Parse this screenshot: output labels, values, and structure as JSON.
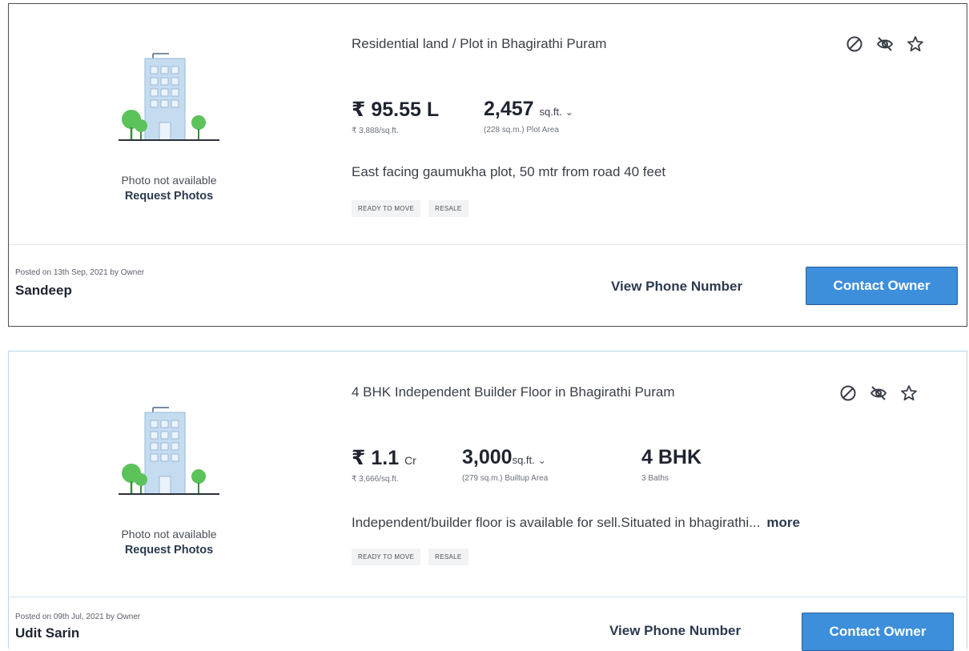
{
  "listings": [
    {
      "title": "Residential land / Plot in Bhagirathi Puram",
      "price": "₹ 95.55 L",
      "price_unit": "",
      "price_per_sqft": "₹ 3,888/sq.ft.",
      "area_value": "2,457",
      "area_unit": "sq.ft.",
      "area_note": "(228 sq.m.) Plot Area",
      "bhk": "",
      "baths": "",
      "description": "East facing gaumukha plot, 50 mtr from road 40 feet",
      "more_label": "",
      "tags": [
        "READY TO MOVE",
        "RESALE"
      ],
      "photo_status": "Photo not available",
      "request_photos_label": "Request Photos",
      "posted": "Posted on 13th Sep, 2021 by Owner",
      "owner_name": "Sandeep",
      "view_phone_label": "View Phone Number",
      "contact_label": "Contact Owner"
    },
    {
      "title": "4 BHK Independent Builder Floor in Bhagirathi Puram",
      "price": "₹ 1.1",
      "price_unit": "Cr",
      "price_per_sqft": "₹ 3,666/sq.ft.",
      "area_value": "3,000",
      "area_unit": "sq.ft.",
      "area_note": "(279 sq.m.) Builtup Area",
      "bhk": "4 BHK",
      "baths": "3 Baths",
      "description": "Independent/builder floor is available for sell.Situated in bhagirathi...",
      "more_label": "more",
      "tags": [
        "READY TO MOVE",
        "RESALE"
      ],
      "photo_status": "Photo not available",
      "request_photos_label": "Request Photos",
      "posted": "Posted on 09th Jul, 2021 by Owner",
      "owner_name": "Udit Sarin",
      "view_phone_label": "View Phone Number",
      "contact_label": "Contact Owner"
    }
  ],
  "icons": [
    "block-icon",
    "hide-icon",
    "star-icon"
  ],
  "colors": {
    "accent": "#3d8fdc",
    "card2_border": "#b9d7ea"
  }
}
